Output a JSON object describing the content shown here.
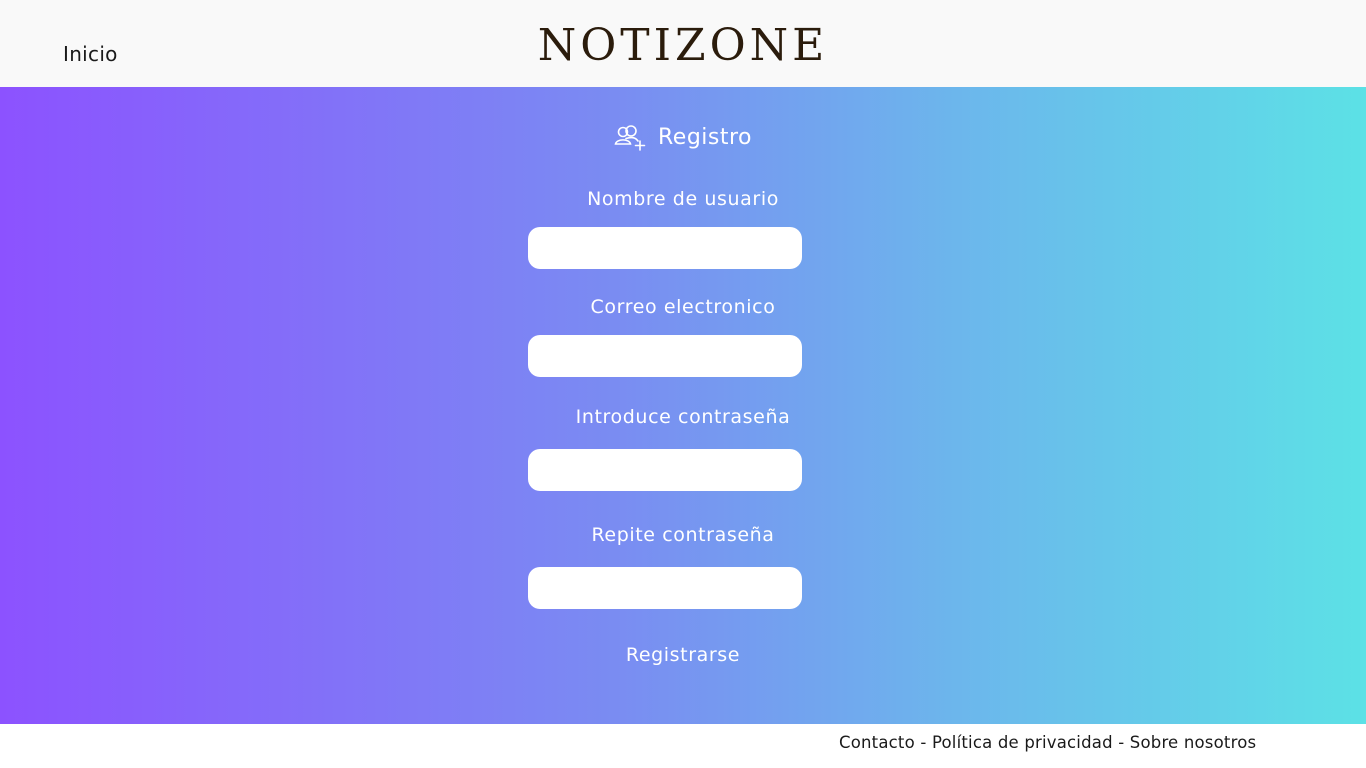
{
  "header": {
    "nav_home_label": "Inicio",
    "logo_text": "NOTIZONE"
  },
  "form": {
    "title": "Registro",
    "title_icon": "add-users-icon",
    "fields": [
      {
        "label": "Nombre de usuario",
        "value": "",
        "placeholder": ""
      },
      {
        "label": "Correo electronico",
        "value": "",
        "placeholder": ""
      },
      {
        "label": "Introduce contraseña",
        "value": "",
        "placeholder": ""
      },
      {
        "label": "Repite contraseña",
        "value": "",
        "placeholder": ""
      }
    ],
    "submit_label": "Registrarse"
  },
  "footer": {
    "contact_label": "Contacto",
    "privacy_label": "Política de privacidad",
    "about_label": "Sobre nosotros",
    "separator": " - "
  },
  "colors": {
    "gradient_start": "#8c52ff",
    "gradient_end": "#5ce1e6",
    "logo": "#2b1c0c",
    "header_bg": "#f9f9f9"
  }
}
